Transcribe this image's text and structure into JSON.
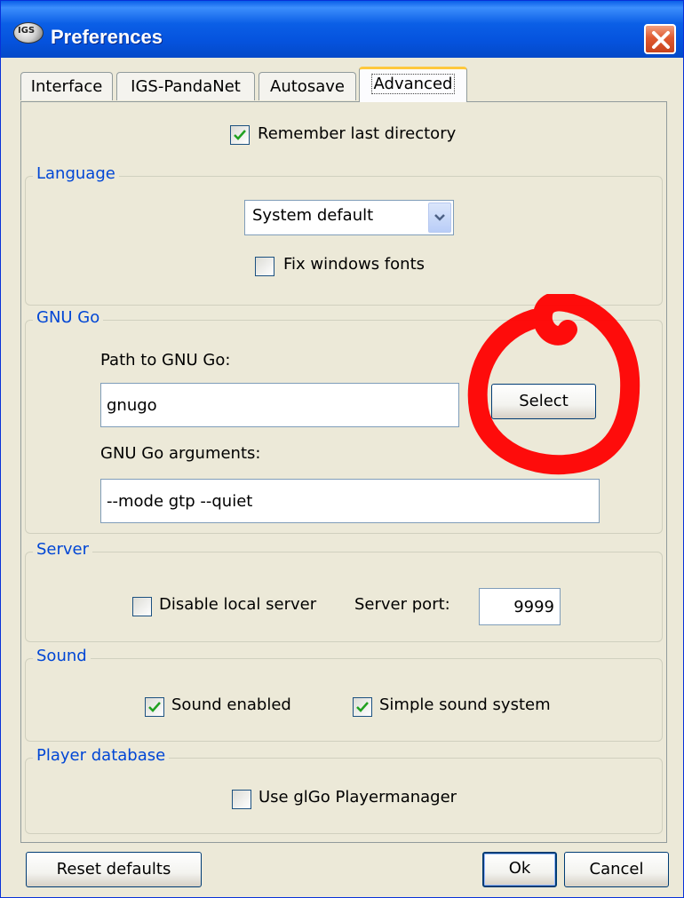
{
  "window": {
    "title": "Preferences",
    "app_icon": "glgo-app-icon",
    "close_icon": "close-icon"
  },
  "tabs": [
    {
      "label": "Interface",
      "active": false
    },
    {
      "label": "IGS-PandaNet",
      "active": false
    },
    {
      "label": "Autosave",
      "active": false
    },
    {
      "label": "Advanced",
      "active": true
    }
  ],
  "general": {
    "remember_last_directory": {
      "label": "Remember last directory",
      "checked": true
    }
  },
  "language": {
    "title": "Language",
    "select_value": "System default",
    "fix_fonts": {
      "label": "Fix windows fonts",
      "checked": false
    }
  },
  "gnugo": {
    "title": "GNU Go",
    "path_label": "Path to GNU Go:",
    "path_value": "gnugo",
    "select_button": "Select",
    "args_label": "GNU Go arguments:",
    "args_value": "--mode gtp --quiet"
  },
  "server": {
    "title": "Server",
    "disable_local": {
      "label": "Disable local server",
      "checked": false
    },
    "port_label": "Server port:",
    "port_value": "9999"
  },
  "sound": {
    "title": "Sound",
    "enabled": {
      "label": "Sound enabled",
      "checked": true
    },
    "simple": {
      "label": "Simple sound system",
      "checked": true
    }
  },
  "player_database": {
    "title": "Player database",
    "use_manager": {
      "label": "Use glGo Playermanager",
      "checked": false
    }
  },
  "footer": {
    "reset": "Reset defaults",
    "ok": "Ok",
    "cancel": "Cancel"
  },
  "colors": {
    "accent_title": "#0046d5",
    "annotation": "#ff0000",
    "titlebar": "#0553de"
  }
}
